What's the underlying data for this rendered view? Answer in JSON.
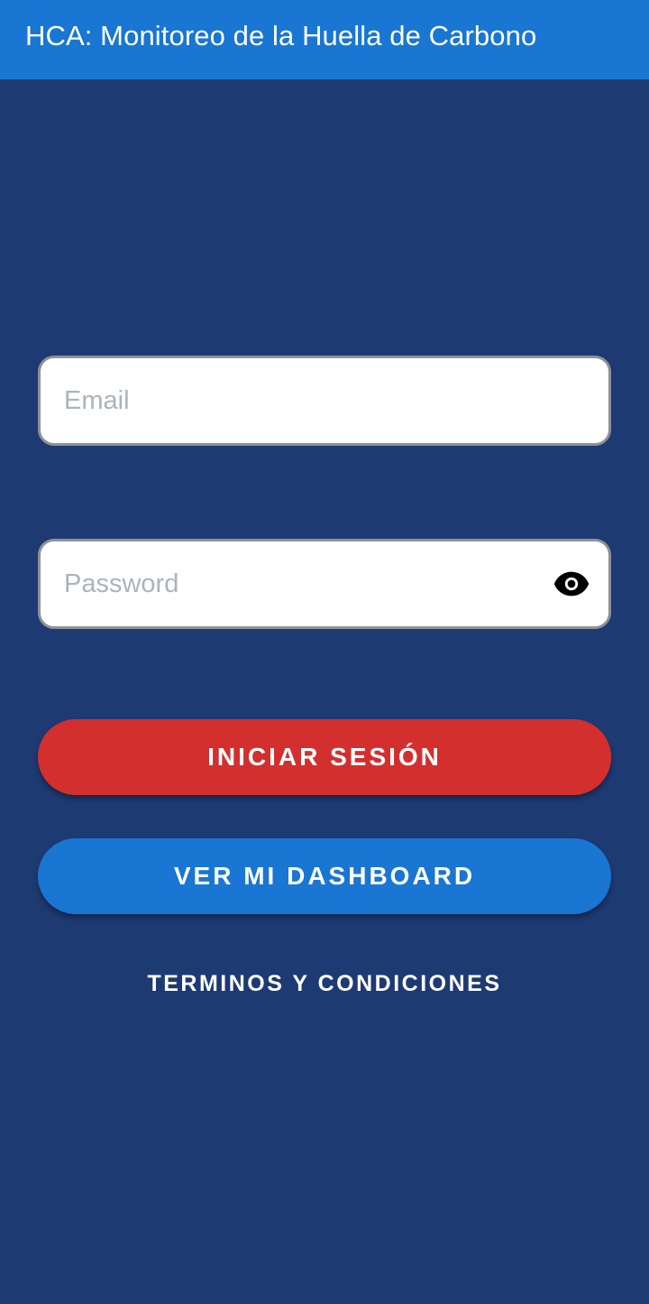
{
  "app_bar": {
    "title": "HCA: Monitoreo de la Huella de Carbono"
  },
  "login_form": {
    "email": {
      "placeholder": "Email",
      "value": ""
    },
    "password": {
      "placeholder": "Password",
      "value": "",
      "toggle_icon": "eye-icon"
    },
    "login_button_label": "INICIAR SESIÓN",
    "dashboard_button_label": "VER MI DASHBOARD",
    "terms_link_label": "TERMINOS Y CONDICIONES"
  },
  "colors": {
    "background": "#1e3a73",
    "app_bar": "#1976d2",
    "login_button": "#d32f2f",
    "dashboard_button": "#1976d2",
    "placeholder_text": "#a9b4bd"
  }
}
